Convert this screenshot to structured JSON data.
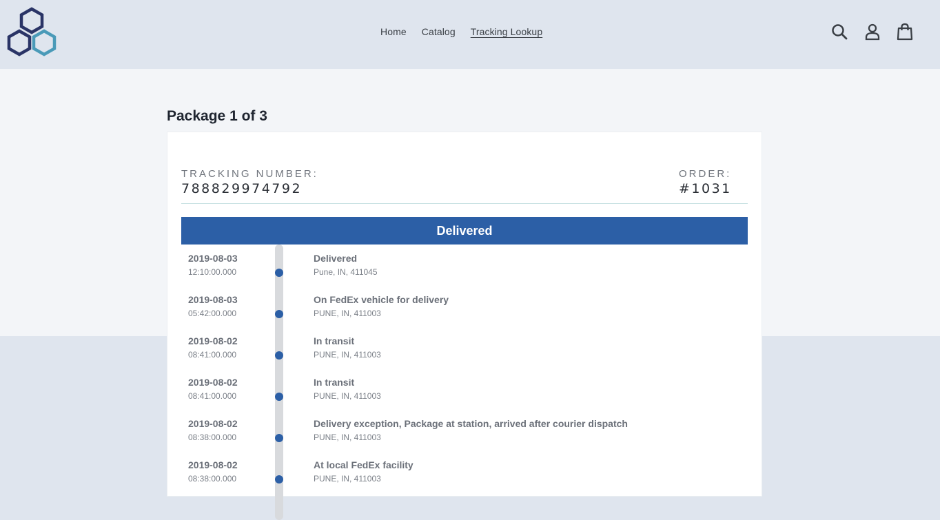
{
  "header": {
    "logo_icon": "hexagon-cluster-logo",
    "nav": [
      {
        "label": "Home"
      },
      {
        "label": "Catalog"
      },
      {
        "label": "Tracking Lookup",
        "active": true
      }
    ],
    "icons": [
      "search-icon",
      "account-icon",
      "cart-icon"
    ]
  },
  "package": {
    "title": "Package 1 of 3",
    "tracking_label": "TRACKING NUMBER:",
    "tracking_number": "788829974792",
    "order_label": "ORDER:",
    "order_number": "#1031",
    "status": "Delivered"
  },
  "events": [
    {
      "date": "2019-08-03",
      "time": "12:10:00.000",
      "title": "Delivered",
      "location": "Pune, IN, 411045"
    },
    {
      "date": "2019-08-03",
      "time": "05:42:00.000",
      "title": "On FedEx vehicle for delivery",
      "location": "PUNE, IN, 411003"
    },
    {
      "date": "2019-08-02",
      "time": "08:41:00.000",
      "title": "In transit",
      "location": "PUNE, IN, 411003"
    },
    {
      "date": "2019-08-02",
      "time": "08:41:00.000",
      "title": "In transit",
      "location": "PUNE, IN, 411003"
    },
    {
      "date": "2019-08-02",
      "time": "08:38:00.000",
      "title": "Delivery exception, Package at station, arrived after courier dispatch",
      "location": "PUNE, IN, 411003"
    },
    {
      "date": "2019-08-02",
      "time": "08:38:00.000",
      "title": "At local FedEx facility",
      "location": "PUNE, IN, 411003"
    }
  ],
  "colors": {
    "brand_dark": "#2a3466",
    "brand_light": "#4a9ab8",
    "status_bar": "#2c5fa6",
    "header_bg": "#dfe5ee"
  }
}
